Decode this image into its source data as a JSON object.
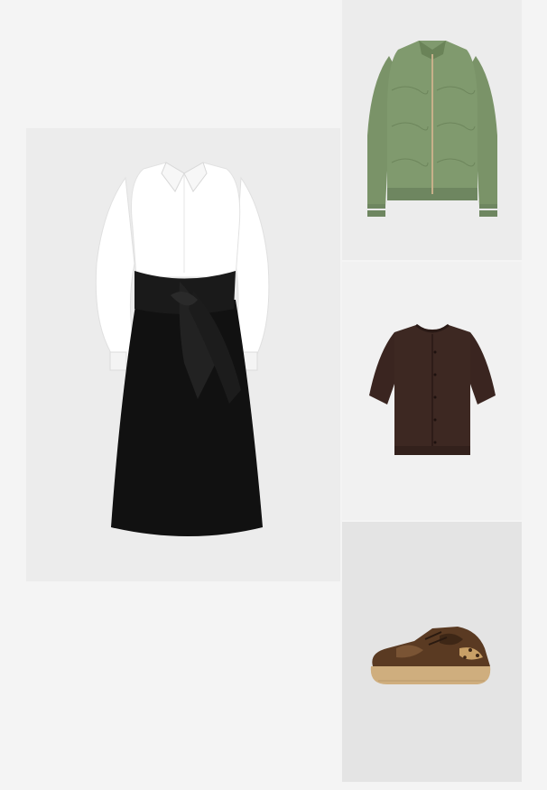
{
  "outfit": {
    "items": [
      {
        "name": "shirt-dress",
        "icon": "dress-icon",
        "colors": [
          "#ffffff",
          "#111111"
        ]
      },
      {
        "name": "quilted-bomber-jacket",
        "icon": "jacket-icon",
        "colors": [
          "#7a9368"
        ]
      },
      {
        "name": "short-sleeve-cardigan",
        "icon": "cardigan-icon",
        "colors": [
          "#3a2520"
        ]
      },
      {
        "name": "sneaker",
        "icon": "sneaker-icon",
        "colors": [
          "#5a3a22",
          "#cfae7e"
        ]
      }
    ]
  }
}
